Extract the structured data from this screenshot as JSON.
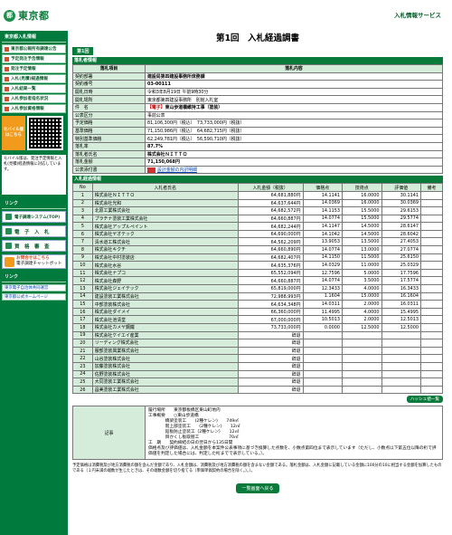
{
  "logo_text": "東京都",
  "header": {
    "service_link": "入札情報サービス",
    "page_title": "第1回　入札経過調書",
    "round_tab": "第1回"
  },
  "sidebar": {
    "section1": "東京都入札情報",
    "items": [
      {
        "label": "東京都公報所有調達公告"
      },
      {
        "label": "予定発注予告情報"
      },
      {
        "label": "発注予定情報"
      },
      {
        "label": "入札(見積)経過情報"
      },
      {
        "label": "入札結果一覧"
      },
      {
        "label": "入札参加者指名状況"
      },
      {
        "label": "入札参加資格情報"
      }
    ],
    "mobile_badge": "モバイル版",
    "mobile_sub": "はこちら",
    "mobile_note": "モバイル版は、発注予定情報と入札(見積)経過情報に対応しています。",
    "section2": "リンク",
    "system_link": "電子調達システム(TOP)",
    "big_buttons": [
      "電　子　入　札",
      "資　格　審　査"
    ],
    "chat_title": "お問合せはこちら",
    "chat_sub": "電子調達チャットボット",
    "section3": "リンク",
    "links": [
      "東京電子自治体共同運営",
      "東京都公式ホームページ"
    ]
  },
  "info": {
    "bar_title": "落札者情報",
    "col_item": "落札項目",
    "col_content": "落札内容",
    "rows": [
      {
        "k": "契約部署",
        "v": "建設局第四建設事務所庶務課",
        "bold": true
      },
      {
        "k": "契約番号",
        "v": "03-00111",
        "bold": true
      },
      {
        "k": "開札日時",
        "v": "令和3年8月19日 午前9時30分"
      },
      {
        "k": "開札場所",
        "v": "東京都第四建設事務所　別館入札室"
      },
      {
        "k": "件　名",
        "tag": "【電子】",
        "v": "東山歩道橋維持工事（塗装）",
        "bold": true
      },
      {
        "k": "公表区分",
        "v": "事前公表"
      },
      {
        "k": "予定価格",
        "v": "81,106,300円（税込）　73,733,000円（税抜）"
      },
      {
        "k": "基準価格",
        "v": "71,150,986円（税込）　64,682,715円（税抜）"
      },
      {
        "k": "特別基準価格",
        "v": "62,249,781円（税込）　56,590,710円（税抜）"
      },
      {
        "k": "落札率",
        "v": "87.7%",
        "bold": true
      },
      {
        "k": "落札者氏名",
        "v": "株式会社ＮＩＴＴＯ",
        "bold": true
      },
      {
        "k": "落札金額",
        "v": "71,150,068円",
        "bold": true
      },
      {
        "k": "公表添付書",
        "v": "設計金額の内訳明細",
        "file": true
      }
    ]
  },
  "results": {
    "bar_title": "入札経過情報",
    "headers": [
      "No",
      "入札者氏名",
      "入札金額（税抜）",
      "価格点",
      "技術点",
      "評価値",
      "備考"
    ],
    "rows": [
      [
        "1",
        "株式会社ＮＩＴＴＯ",
        "64,681,880円",
        "14.1141",
        "16.0000",
        "30.1141",
        ""
      ],
      [
        "2",
        "株式会社光和",
        "64,637,644円",
        "14.0369",
        "16.0000",
        "30.0369",
        ""
      ],
      [
        "3",
        "北原工業株式会社",
        "64,682,572円",
        "14.1153",
        "15.5000",
        "29.6153",
        ""
      ],
      [
        "4",
        "プラチナ塗装工業株式会社",
        "64,660,887円",
        "14.0774",
        "15.5000",
        "29.5774",
        ""
      ],
      [
        "5",
        "株式会社アップルペイント",
        "64,682,244円",
        "14.1147",
        "14.5000",
        "28.6147",
        ""
      ],
      [
        "6",
        "株式会社ヤオテック",
        "64,690,000円",
        "14.1042",
        "14.5000",
        "28.6042",
        ""
      ],
      [
        "7",
        "清水道工株式会社",
        "64,562,209円",
        "13.9053",
        "13.5000",
        "27.4053",
        ""
      ],
      [
        "8",
        "株式会社キクチ",
        "64,660,890円",
        "14.0774",
        "13.0000",
        "27.0774",
        ""
      ],
      [
        "9",
        "株式会社中村塗装店",
        "64,682,407円",
        "14.1150",
        "11.5000",
        "25.6150",
        ""
      ],
      [
        "10",
        "株式会社水谷",
        "64,635,376円",
        "14.0329",
        "11.0000",
        "25.0329",
        ""
      ],
      [
        "11",
        "株式会社ナプコ",
        "65,552,094円",
        "12.7596",
        "5.0000",
        "17.7596",
        ""
      ],
      [
        "12",
        "株式会社森野",
        "64,660,887円",
        "14.0774",
        "3.5000",
        "17.5774",
        ""
      ],
      [
        "13",
        "株式会社ジェイテック",
        "65,819,000円",
        "12.3433",
        "4.0000",
        "16.3433",
        ""
      ],
      [
        "14",
        "建設塗装工業株式会社",
        "72,988,993円",
        "1.1604",
        "15.0000",
        "16.1604",
        ""
      ],
      [
        "15",
        "中部塗装株式会社",
        "64,634,348円",
        "14.0311",
        "2.0000",
        "16.0311",
        ""
      ],
      [
        "16",
        "株式会社ダイメイ",
        "66,360,000円",
        "11.4995",
        "4.0000",
        "15.4995",
        ""
      ],
      [
        "17",
        "株式会社池清堂",
        "67,000,000円",
        "10.5013",
        "2.0000",
        "12.5013",
        ""
      ],
      [
        "18",
        "株式会社カメヤ鋼鐵",
        "73,733,000円",
        "0.0000",
        "12.5000",
        "12.5000",
        ""
      ],
      [
        "19",
        "株式会社ケイエイ産業",
        "辞退",
        "",
        "",
        "",
        ""
      ],
      [
        "20",
        "リーディング株式会社",
        "辞退",
        "",
        "",
        "",
        ""
      ],
      [
        "21",
        "服部塗装興業株式会社",
        "辞退",
        "",
        "",
        "",
        ""
      ],
      [
        "22",
        "山谷塗装株式会社",
        "辞退",
        "",
        "",
        "",
        ""
      ],
      [
        "23",
        "加藤塗装株式会社",
        "辞退",
        "",
        "",
        "",
        ""
      ],
      [
        "24",
        "佐野塗装株式会社",
        "辞退",
        "",
        "",
        "",
        ""
      ],
      [
        "25",
        "大同塗装工業株式会社",
        "辞退",
        "",
        "",
        "",
        ""
      ],
      [
        "26",
        "昌美塗装工業株式会社",
        "辞退",
        "",
        "",
        "",
        ""
      ]
    ]
  },
  "graph_button": "ハッシュ値一覧",
  "memo": {
    "label": "記事",
    "lines": [
      "履行場所　　東京都板橋区東山町地内",
      "工事概要　　○東山歩道橋",
      "　　　　橋梁塗装工　　(2種ケレン)　　749㎡",
      "　　　　階上部塗装工　　(2種ケレン)　　12㎡",
      "　　　　鉛板防止塗装工（2種ケレン）　　12㎡",
      "　　　　目かくし板取替工　　　　　　　70㎡",
      "工　期　　契約締結の日の翌日から135日間",
      "価格点及び評価値は、入札金額を本案件公表事項に基づき換算した点数を、小数点第四位まで表示しています（ただし、小数点以下第五位以降の桁で評価値を判定した場合には、判定した桁までで表示している。）。"
    ]
  },
  "footnote": "予定価格は消費税及び地方消費税の額を含んだ金額であり、入札金額は、消費税及び地方消費税の額を含まない金額である。落札金額は、入札金額に記載している金額に100分の10に相当する金額を加算したものである（１円未満の端数が生じたときは、その端数金額を切り捨てる（単価単価契約の場合を除く。）。）。",
  "back_button": "一覧画面へ戻る"
}
